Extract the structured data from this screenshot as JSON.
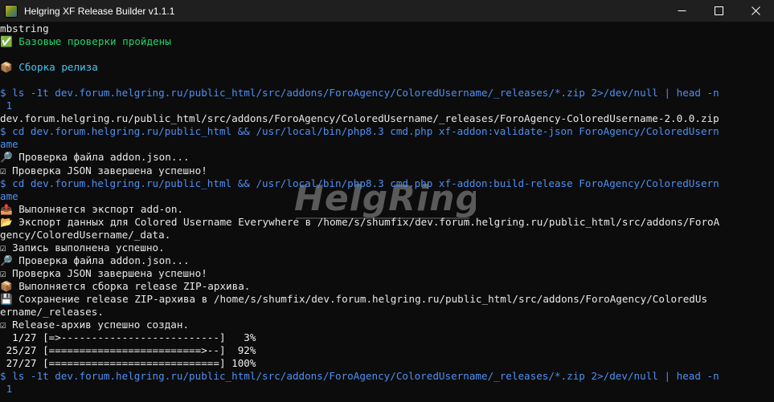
{
  "window": {
    "title": "Helgring XF Release Builder v1.1.1"
  },
  "watermark": {
    "text": "HelgRing"
  },
  "colors": {
    "background": "#0c0c0c",
    "titlebar": "#1f1f1f",
    "default_text": "#e8e8e8",
    "green": "#1fd36a",
    "cyan": "#49c4f2",
    "blue": "#4e8ff2"
  },
  "lines": [
    {
      "text": "mbstring",
      "color": "default"
    },
    {
      "text": "✅ Базовые проверки пройдены",
      "color": "green"
    },
    {
      "text": "",
      "color": "default"
    },
    {
      "text": "📦 Сборка релиза",
      "color": "cyan"
    },
    {
      "text": "",
      "color": "default"
    },
    {
      "text": "$ ls -1t dev.forum.helgring.ru/public_html/src/addons/ForoAgency/ColoredUsername/_releases/*.zip 2>/dev/null | head -n",
      "color": "blue"
    },
    {
      "text": " 1",
      "color": "blue"
    },
    {
      "text": "dev.forum.helgring.ru/public_html/src/addons/ForoAgency/ColoredUsername/_releases/ForoAgency-ColoredUsername-2.0.0.zip",
      "color": "default"
    },
    {
      "text": "$ cd dev.forum.helgring.ru/public_html && /usr/local/bin/php8.3 cmd.php xf-addon:validate-json ForoAgency/ColoredUsern",
      "color": "blue"
    },
    {
      "text": "ame",
      "color": "blue"
    },
    {
      "text": "🔎 Проверка файла addon.json...",
      "color": "default"
    },
    {
      "text": "☑ Проверка JSON завершена успешно!",
      "color": "default"
    },
    {
      "text": "$ cd dev.forum.helgring.ru/public_html && /usr/local/bin/php8.3 cmd.php xf-addon:build-release ForoAgency/ColoredUsern",
      "color": "blue"
    },
    {
      "text": "ame",
      "color": "blue"
    },
    {
      "text": "📤 Выполняется экспорт add-on.",
      "color": "default"
    },
    {
      "text": "📂 Экспорт данных для Colored Username Everywhere в /home/s/shumfix/dev.forum.helgring.ru/public_html/src/addons/ForoA",
      "color": "default"
    },
    {
      "text": "gency/ColoredUsername/_data.",
      "color": "default"
    },
    {
      "text": "☑ Запись выполнена успешно.",
      "color": "default"
    },
    {
      "text": "🔎 Проверка файла addon.json...",
      "color": "default"
    },
    {
      "text": "☑ Проверка JSON завершена успешно!",
      "color": "default"
    },
    {
      "text": "📦 Выполняется сборка release ZIP-архива.",
      "color": "default"
    },
    {
      "text": "💾 Сохранение release ZIP-архива в /home/s/shumfix/dev.forum.helgring.ru/public_html/src/addons/ForoAgency/ColoredUs",
      "color": "default"
    },
    {
      "text": "ername/_releases.",
      "color": "default"
    },
    {
      "text": "☑ Release-архив успешно создан.",
      "color": "default"
    },
    {
      "text": "  1/27 [=>--------------------------]   3%",
      "color": "white"
    },
    {
      "text": " 25/27 [=========================>--]  92%",
      "color": "white"
    },
    {
      "text": " 27/27 [============================] 100%",
      "color": "white"
    },
    {
      "text": "$ ls -1t dev.forum.helgring.ru/public_html/src/addons/ForoAgency/ColoredUsername/_releases/*.zip 2>/dev/null | head -n",
      "color": "blue"
    },
    {
      "text": " 1",
      "color": "blue"
    }
  ]
}
